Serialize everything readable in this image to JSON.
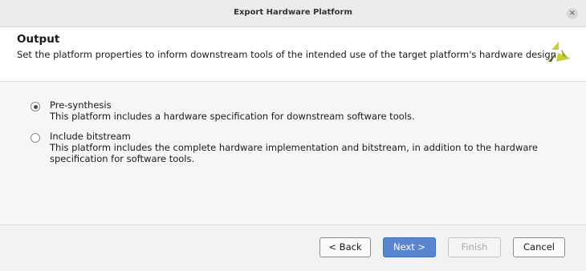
{
  "window": {
    "title": "Export Hardware Platform",
    "close_glyph": "×"
  },
  "header": {
    "title": "Output",
    "description": "Set the platform properties to inform downstream tools of the intended use of the target platform's hardware design.",
    "logo_colors": [
      "#c8d23c",
      "#4a5a1a"
    ]
  },
  "options": [
    {
      "label": "Pre-synthesis",
      "description": "This platform includes a hardware specification for downstream software tools.",
      "selected": true
    },
    {
      "label": "Include bitstream",
      "description": "This platform includes the complete hardware implementation and bitstream, in addition to the hardware specification for software tools.",
      "selected": false
    }
  ],
  "buttons": {
    "back": "< Back",
    "next": "Next >",
    "finish": "Finish",
    "cancel": "Cancel"
  },
  "colors": {
    "primary_button": "#5a86d0"
  }
}
